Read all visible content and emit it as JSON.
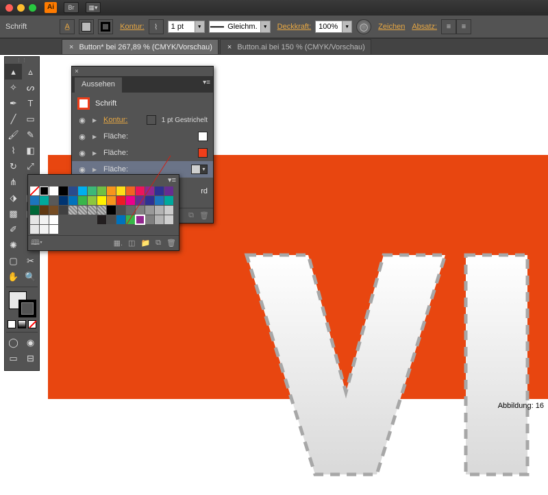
{
  "titlebar": {
    "app": "Ai",
    "btn1": "Br",
    "btn2": "▦▾"
  },
  "control": {
    "mode": "Schrift",
    "kontur": "Kontur:",
    "stroke_width": "1 pt",
    "dash": "Gleichm.",
    "deckkraft": "Deckkraft:",
    "opacity": "100%",
    "zeichen": "Zeichen",
    "absatz": "Absatz:"
  },
  "tabs": [
    {
      "label": "Button* bei 267,89 % (CMYK/Vorschau)",
      "active": true
    },
    {
      "label": "Button.ai bei 150 % (CMYK/Vorschau)",
      "active": false
    }
  ],
  "appearance": {
    "title": "Aussehen",
    "target": "Schrift",
    "rows": [
      {
        "label": "Kontur:",
        "link": true,
        "value": "1 pt Gestrichelt",
        "swatch": "#bfbfbf"
      },
      {
        "label": "Fläche:",
        "swatch": "#ffffff"
      },
      {
        "label": "Fläche:",
        "swatch": "#ef3e1a"
      },
      {
        "label": "Fläche:",
        "swatch": "#cfcfcf",
        "selected": true
      }
    ],
    "extra": "rd"
  },
  "swatches_colors": [
    "none",
    "reg",
    "#ffffff",
    "#000000",
    "#2a4b8d",
    "#00aeef",
    "#3cb878",
    "#71bf44",
    "#f7941d",
    "#ffde17",
    "#f26522",
    "#ed145b",
    "#92278f",
    "#2e3192",
    "#662d91",
    "#1c75bc",
    "#00a99d",
    "#595959",
    "#003471",
    "#0072bc",
    "#39b54a",
    "#8dc63f",
    "#fff200",
    "#f7941d",
    "#ed1c24",
    "#ec008c",
    "#662d91",
    "#2e3192",
    "#1c75bc",
    "#00a99d",
    "#006838",
    "#603913",
    "#754c24",
    "#404041",
    "pat1",
    "pat2",
    "pat3",
    "pat4",
    "#000000",
    "#4d4d4d",
    "#666666",
    "#808080",
    "#999999",
    "#b3b3b3",
    "#cccccc",
    "#e6e6e6",
    "#f2f2f2",
    "#ffffff",
    "",
    "",
    "",
    "",
    "#231f20",
    "#4d4d4d",
    "#0072bc",
    "#39b54a",
    "#92278f",
    "#808080",
    "#b3b3b3",
    "#cfcfcf",
    "#e6e6e6",
    "#f2f2f2",
    "#ffffff"
  ],
  "swatches_selected_index": 56,
  "canvas": {
    "text": "VIN"
  },
  "caption": "Abbildung: 16"
}
